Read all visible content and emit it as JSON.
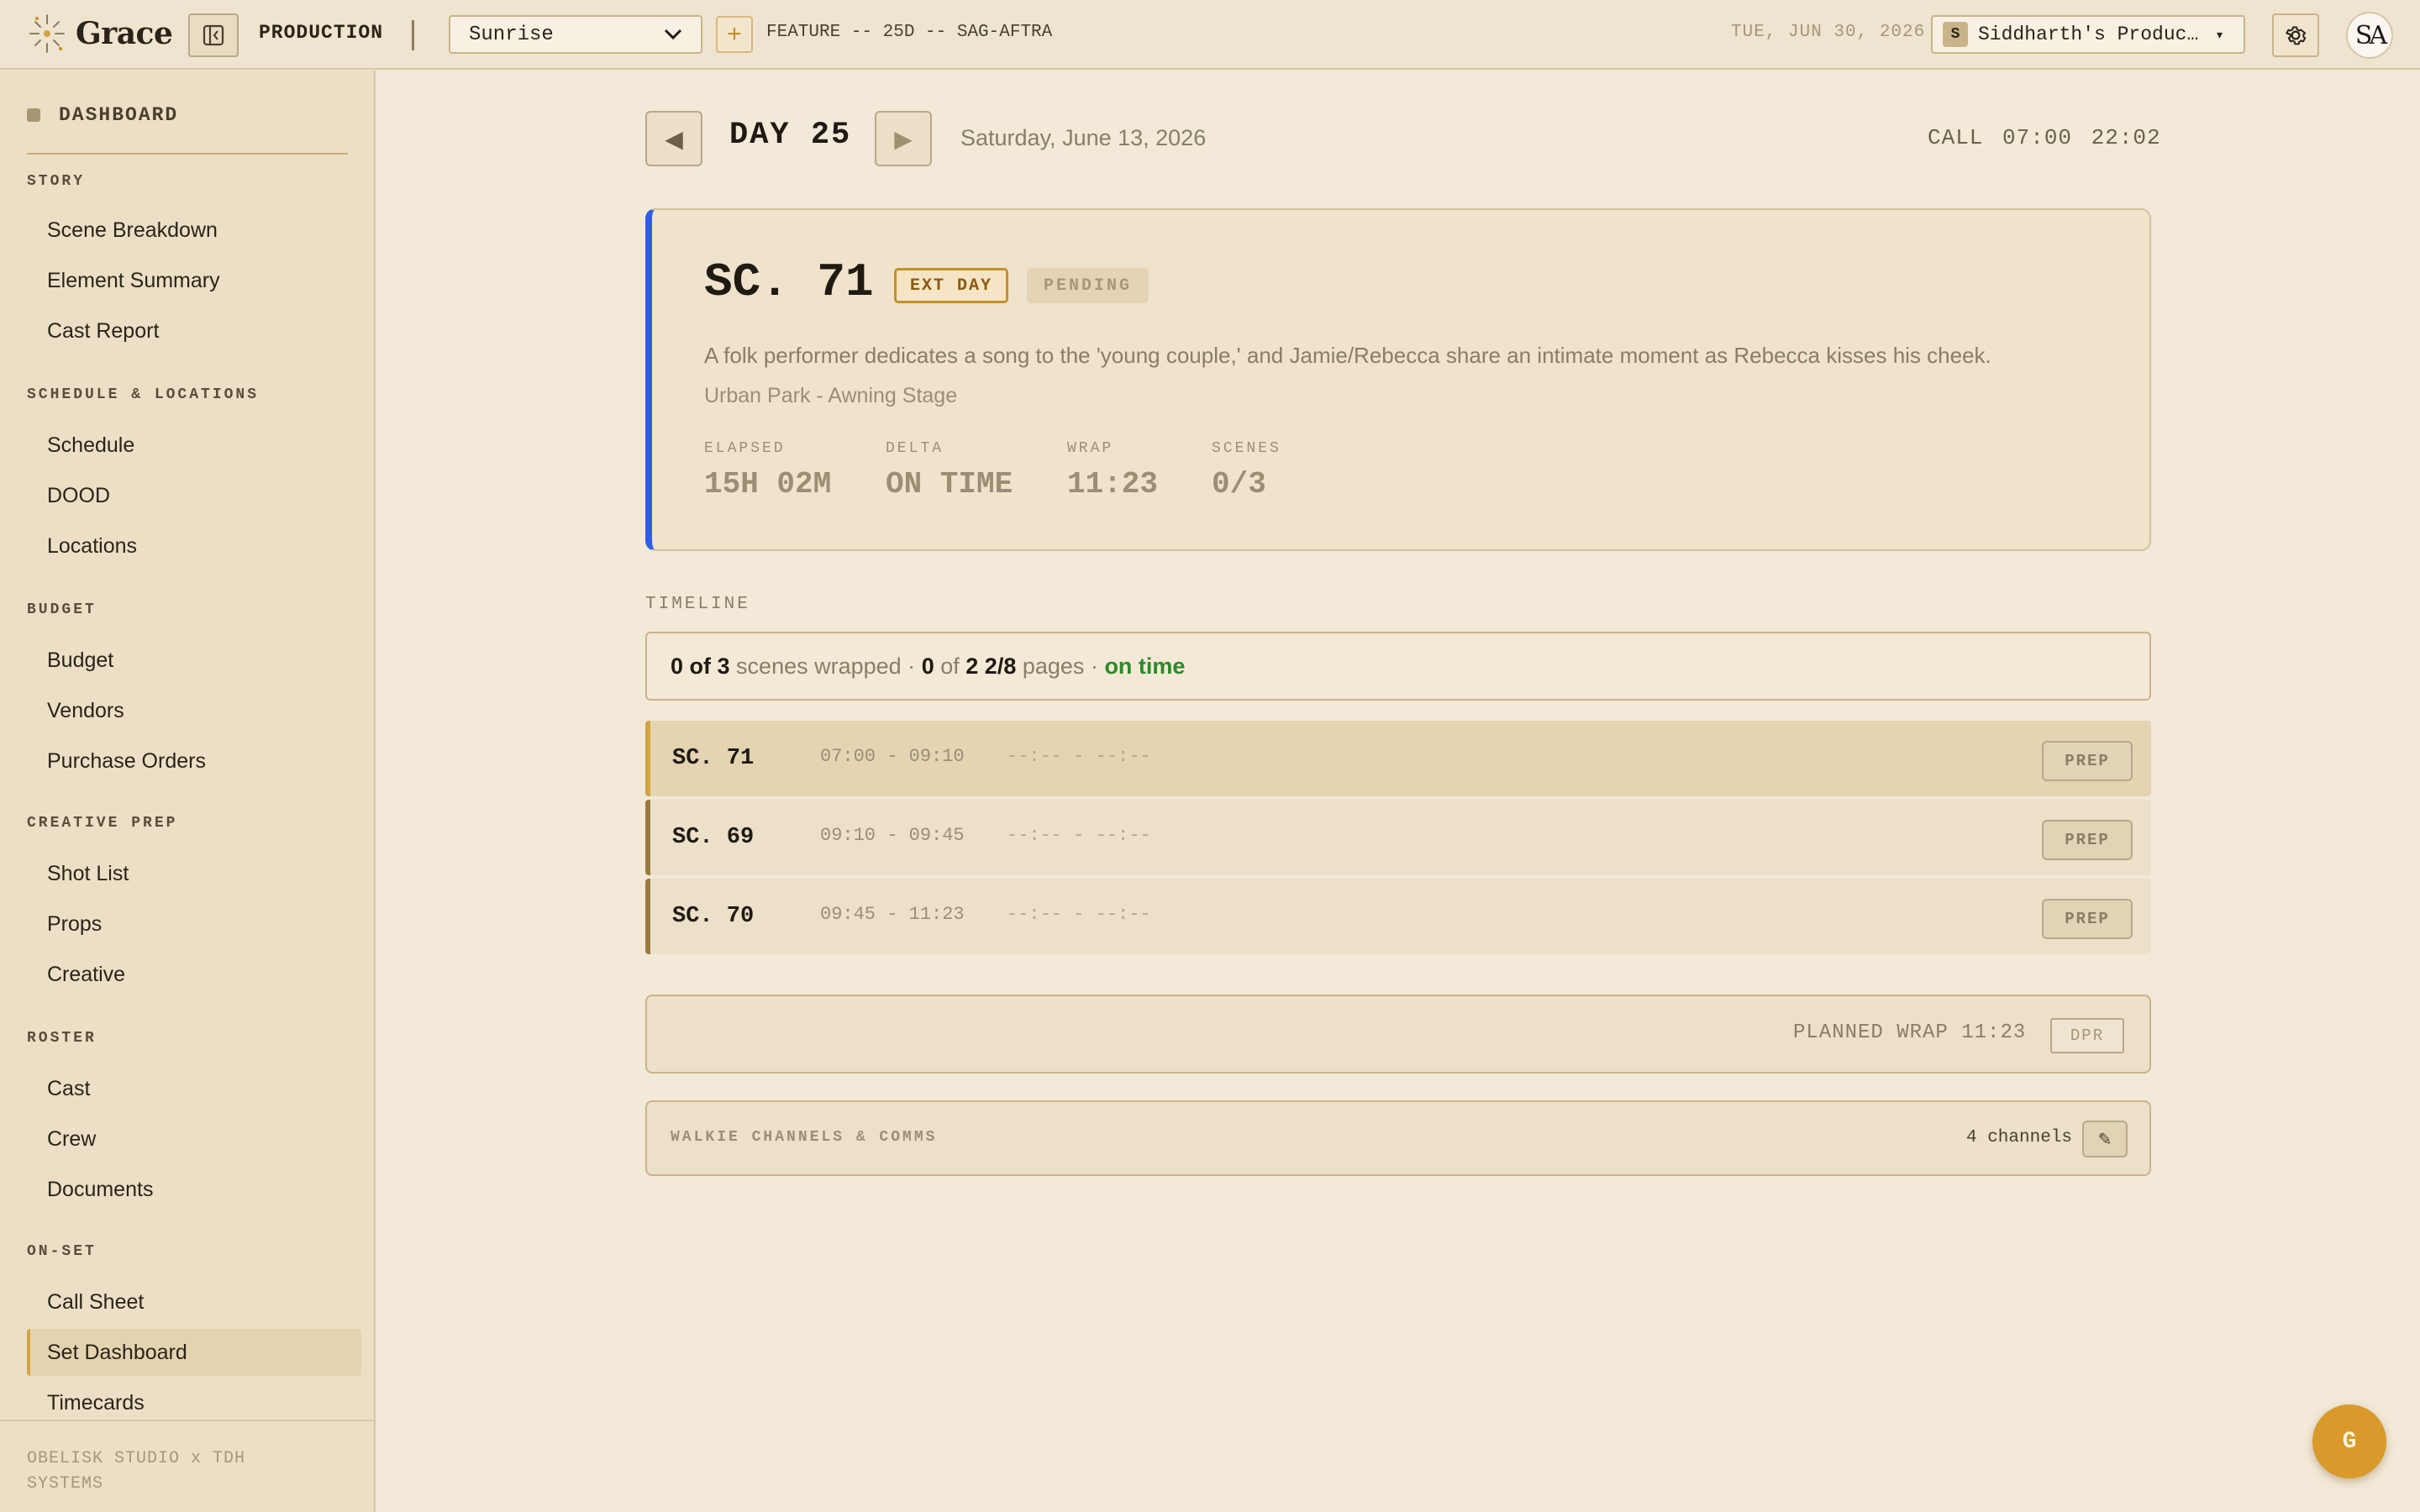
{
  "topbar": {
    "app_name": "Grace",
    "section_label": "PRODUCTION",
    "project_selected": "Sunrise",
    "add_label": "+",
    "project_meta": "FEATURE -- 25D -- SAG-AFTRA",
    "current_date": "TUE, JUN 30, 2026",
    "org_badge": "S",
    "org_name": "Siddharth's Production",
    "org_caret": "▾",
    "avatar_initials": "SA"
  },
  "sidebar": {
    "dashboard_label": "DASHBOARD",
    "sections": [
      {
        "title": "STORY",
        "items": [
          "Scene Breakdown",
          "Element Summary",
          "Cast Report"
        ]
      },
      {
        "title": "SCHEDULE & LOCATIONS",
        "items": [
          "Schedule",
          "DOOD",
          "Locations"
        ]
      },
      {
        "title": "BUDGET",
        "items": [
          "Budget",
          "Vendors",
          "Purchase Orders"
        ]
      },
      {
        "title": "CREATIVE PREP",
        "items": [
          "Shot List",
          "Props",
          "Creative"
        ]
      },
      {
        "title": "ROSTER",
        "items": [
          "Cast",
          "Crew",
          "Documents"
        ]
      },
      {
        "title": "ON-SET",
        "items": [
          "Call Sheet",
          "Set Dashboard",
          "Timecards"
        ]
      }
    ],
    "active_item": "Set Dashboard",
    "footer": "OBELISK STUDIO x TDH SYSTEMS"
  },
  "day": {
    "prev_label": "◀",
    "next_label": "▶",
    "title": "DAY 25",
    "date": "Saturday, June 13, 2026",
    "call": "CALL 07:00  22:02"
  },
  "scene": {
    "title": "SC. 71",
    "badge_ext": "EXT DAY",
    "badge_status": "PENDING",
    "description": "A folk performer dedicates a song to the 'young couple,' and Jamie/Rebecca share an intimate moment as Rebecca kisses his cheek.",
    "location": "Urban Park - Awning Stage",
    "stats": [
      {
        "label": "ELAPSED",
        "value": "15H 02M"
      },
      {
        "label": "DELTA",
        "value": "ON TIME"
      },
      {
        "label": "WRAP",
        "value": "11:23"
      },
      {
        "label": "SCENES",
        "value": "0/3"
      }
    ]
  },
  "timeline": {
    "label": "TIMELINE",
    "summary": {
      "wrapped": "0 of 3",
      "scenes_text": "scenes wrapped ·",
      "pages_done": "0",
      "of_text": "of",
      "pages_total": "2 2/8",
      "pages_text": "pages ·",
      "status": "on time"
    },
    "rows": [
      {
        "scene": "SC. 71",
        "planned": "07:00 - 09:10",
        "actual": "--:-- - --:--",
        "action": "PREP"
      },
      {
        "scene": "SC. 69",
        "planned": "09:10 - 09:45",
        "actual": "--:-- - --:--",
        "action": "PREP"
      },
      {
        "scene": "SC. 70",
        "planned": "09:45 - 11:23",
        "actual": "--:-- - --:--",
        "action": "PREP"
      }
    ]
  },
  "wrap": {
    "planned": "PLANNED WRAP 11:23",
    "dpr_label": "DPR"
  },
  "walkie": {
    "label": "WALKIE CHANNELS & COMMS",
    "count": "4 channels",
    "edit_label": "✎"
  },
  "fab": {
    "label": "G"
  },
  "colors": {
    "background": "#f2e9d8",
    "accent": "#d2a442",
    "current_scene_border": "#2f5fe0",
    "on_time": "#2b8a2b",
    "fab": "#d99a2b"
  }
}
